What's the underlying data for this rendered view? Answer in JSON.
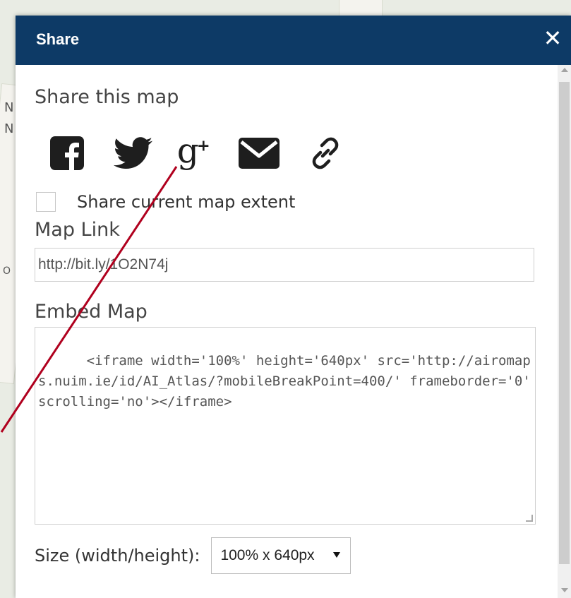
{
  "dialog": {
    "title": "Share",
    "close_symbol": "✕"
  },
  "share": {
    "heading": "Share this map",
    "icons": [
      {
        "name": "facebook-icon"
      },
      {
        "name": "twitter-icon"
      },
      {
        "name": "google-plus-icon"
      },
      {
        "name": "email-icon"
      },
      {
        "name": "link-icon"
      }
    ],
    "extent_label": "Share current map extent",
    "extent_checked": false
  },
  "map_link": {
    "heading": "Map Link",
    "value": "http://bit.ly/1O2N74j"
  },
  "embed": {
    "heading": "Embed Map",
    "code": "<iframe width='100%' height='640px' src='http://airomaps.nuim.ie/id/AI_Atlas/?mobileBreakPoint=400/' frameborder='0' scrolling='no'></iframe>"
  },
  "size": {
    "label": "Size (width/height):",
    "selected": "100% x 640px"
  },
  "colors": {
    "header_bg": "#0d3a66",
    "annotation_line": "#b0001e"
  }
}
